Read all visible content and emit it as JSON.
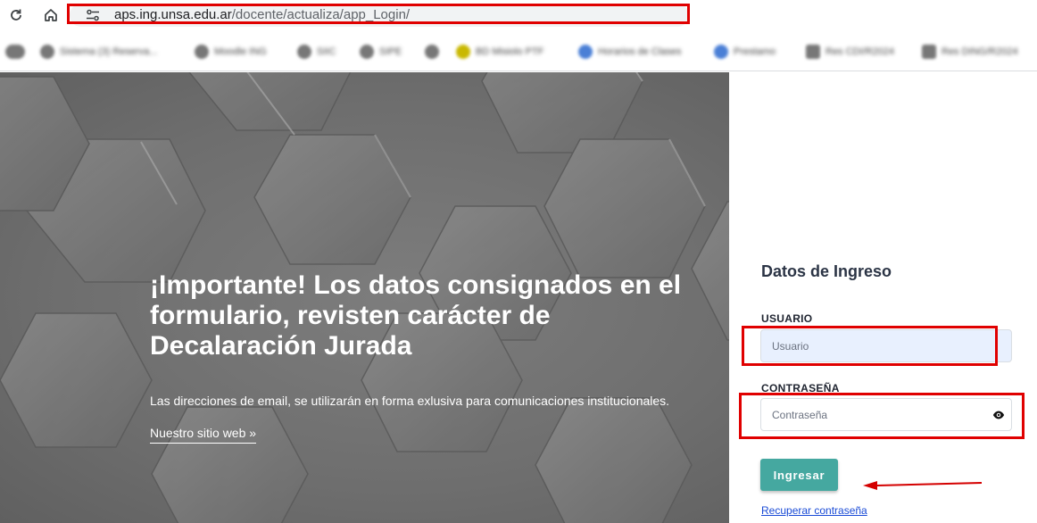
{
  "browser": {
    "url_host": "aps.ing.unsa.edu.ar",
    "url_path": "/docente/actualiza/app_Login/",
    "bookmarks": [
      {
        "label": "Sistema (3) Reserva..."
      },
      {
        "label": "Moodle ING"
      },
      {
        "label": "SIIC"
      },
      {
        "label": "SIPE"
      },
      {
        "label": ""
      },
      {
        "label": "BD Misiolo PTF"
      },
      {
        "label": "Horarios de Clases"
      },
      {
        "label": "Prestamo"
      },
      {
        "label": "Res CDI/R2024"
      },
      {
        "label": "Res DING/R2024"
      }
    ]
  },
  "hero": {
    "title": "¡Importante! Los datos consignados en el formulario, revisten carácter de Decalaración Jurada",
    "text": "Las direcciones de email, se utilizarán en forma exlusiva para comunicaciones institucionales.",
    "link": "Nuestro sitio web »"
  },
  "form": {
    "title": "Datos de Ingreso",
    "user_label": "USUARIO",
    "user_placeholder": "Usuario",
    "pass_label": "CONTRASEÑA",
    "pass_placeholder": "Contraseña",
    "submit": "Ingresar",
    "recover": "Recuperar contraseña"
  },
  "annotations": {
    "highlight_color": "#e00000"
  },
  "colors": {
    "button": "#45a8a0",
    "link": "#1a4bd6",
    "input_filled": "#e8f0fe"
  }
}
